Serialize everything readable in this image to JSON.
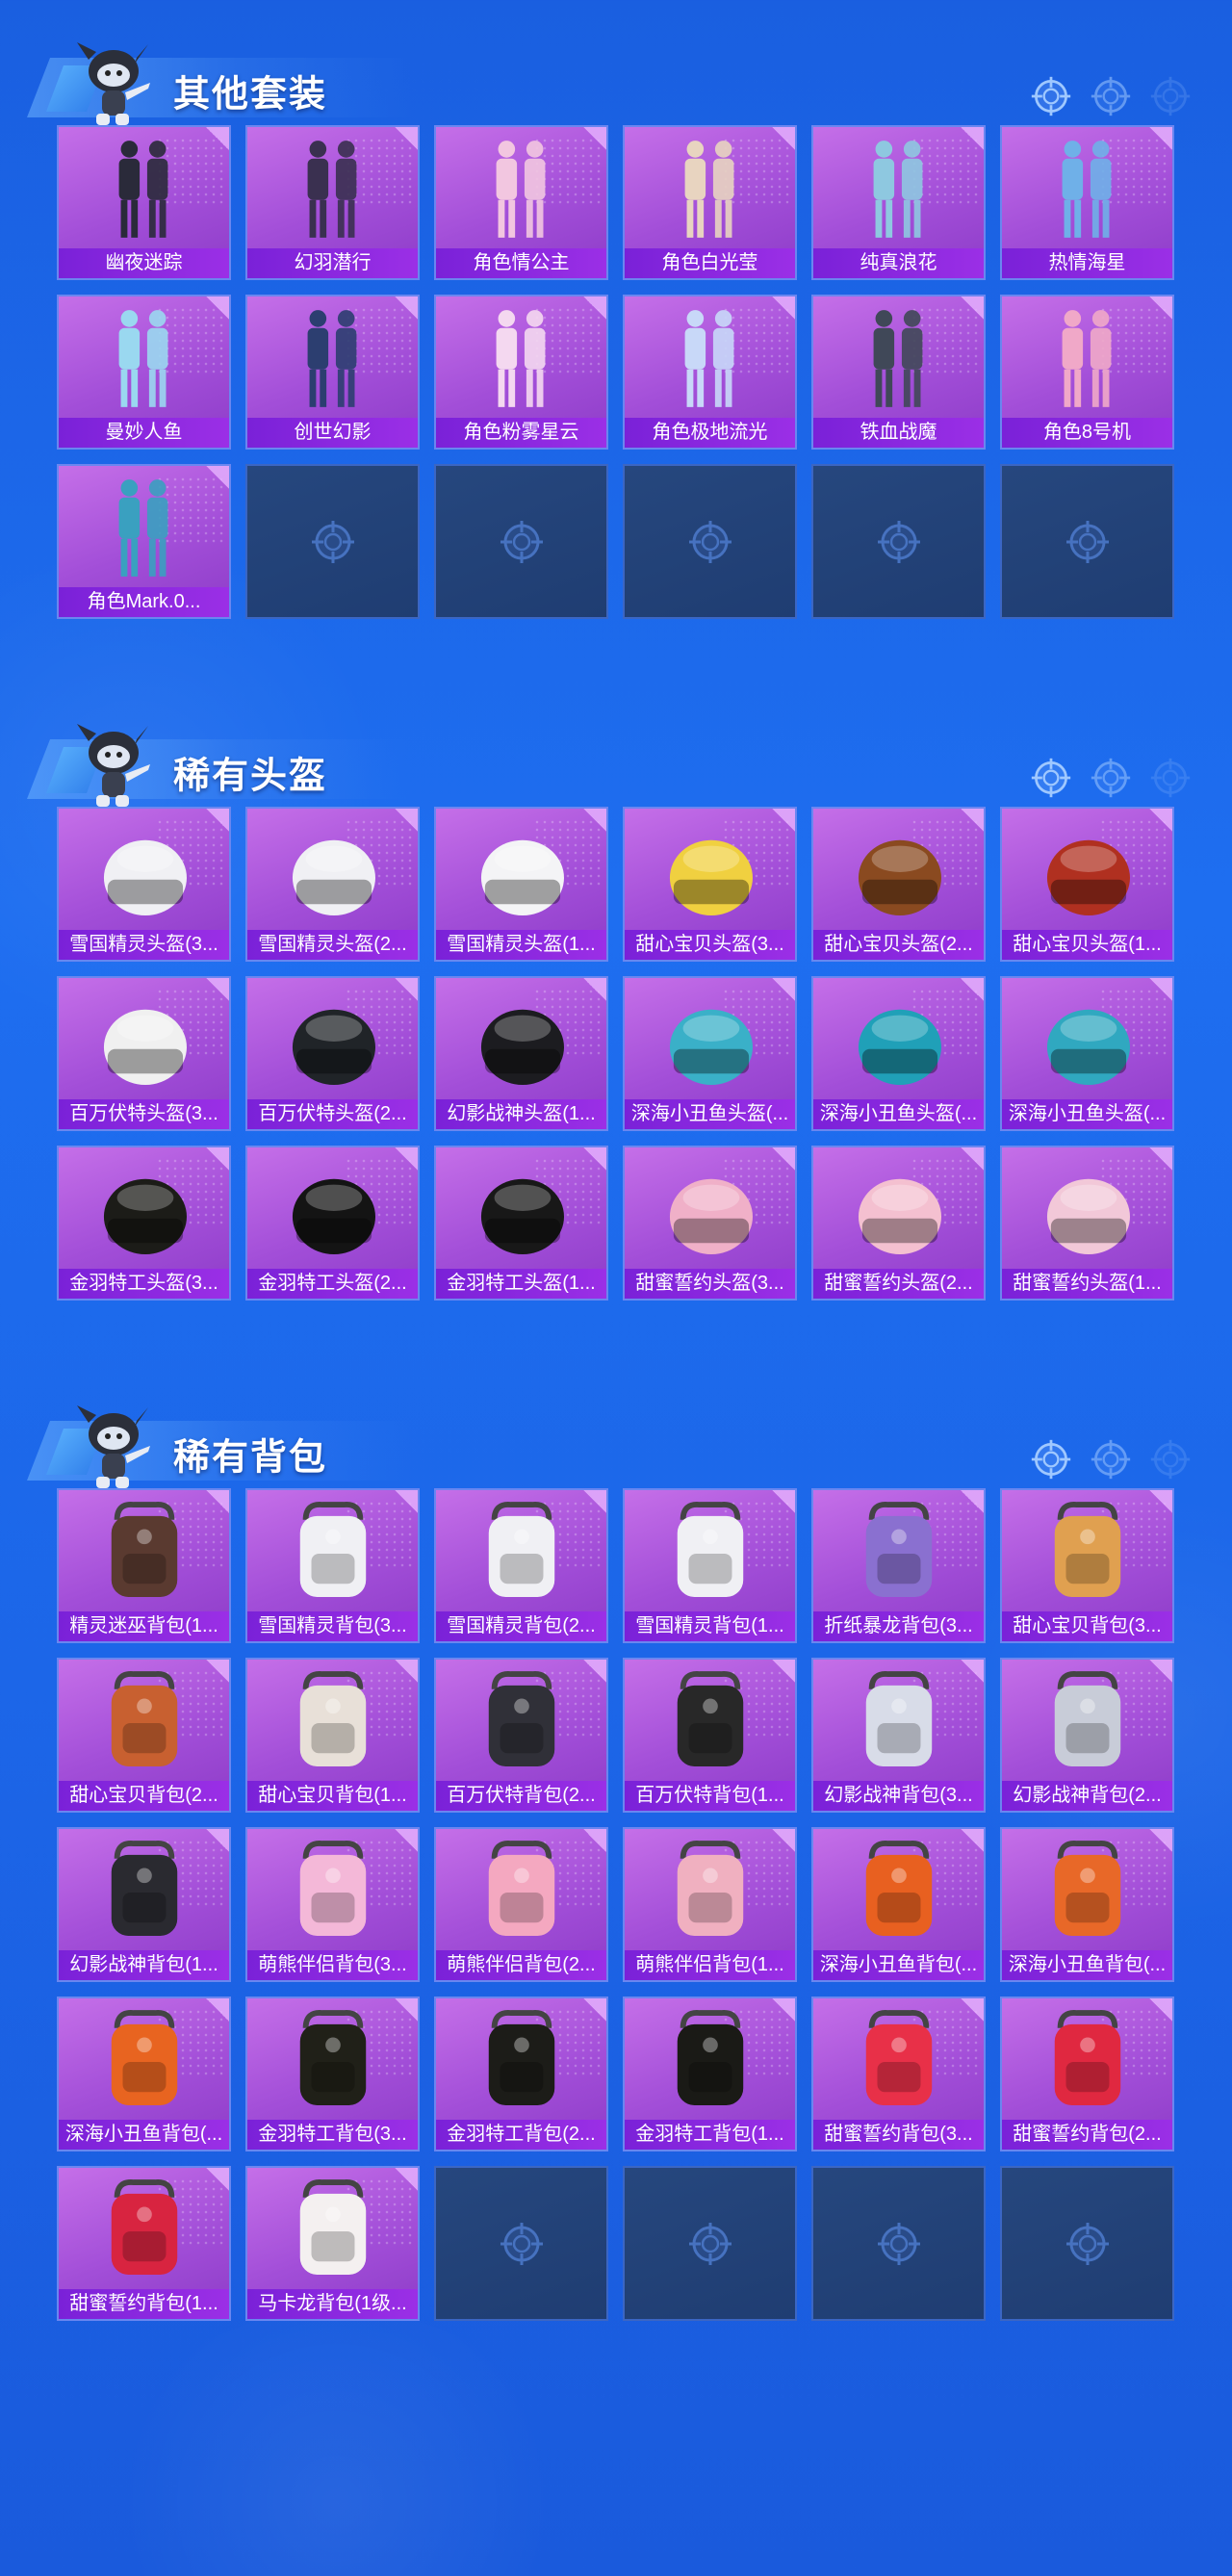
{
  "sections": [
    {
      "title": "其他套装",
      "items": [
        "幽夜迷踪",
        "幻羽潜行",
        "角色情公主",
        "角色白光莹",
        "纯真浪花",
        "热情海星",
        "曼妙人鱼",
        "创世幻影",
        "角色粉雾星云",
        "角色极地流光",
        "铁血战魔",
        "角色8号机",
        "角色Mark.0...",
        "",
        "",
        "",
        "",
        ""
      ]
    },
    {
      "title": "稀有头盔",
      "items": [
        "雪国精灵头盔(3...",
        "雪国精灵头盔(2...",
        "雪国精灵头盔(1...",
        "甜心宝贝头盔(3...",
        "甜心宝贝头盔(2...",
        "甜心宝贝头盔(1...",
        "百万伏特头盔(3...",
        "百万伏特头盔(2...",
        "幻影战神头盔(1...",
        "深海小丑鱼头盔(...",
        "深海小丑鱼头盔(...",
        "深海小丑鱼头盔(...",
        "金羽特工头盔(3...",
        "金羽特工头盔(2...",
        "金羽特工头盔(1...",
        "甜蜜誓约头盔(3...",
        "甜蜜誓约头盔(2...",
        "甜蜜誓约头盔(1..."
      ]
    },
    {
      "title": "稀有背包",
      "items": [
        "精灵迷巫背包(1...",
        "雪国精灵背包(3...",
        "雪国精灵背包(2...",
        "雪国精灵背包(1...",
        "折纸暴龙背包(3...",
        "甜心宝贝背包(3...",
        "甜心宝贝背包(2...",
        "甜心宝贝背包(1...",
        "百万伏特背包(2...",
        "百万伏特背包(1...",
        "幻影战神背包(3...",
        "幻影战神背包(2...",
        "幻影战神背包(1...",
        "萌熊伴侣背包(3...",
        "萌熊伴侣背包(2...",
        "萌熊伴侣背包(1...",
        "深海小丑鱼背包(...",
        "深海小丑鱼背包(...",
        "深海小丑鱼背包(...",
        "金羽特工背包(3...",
        "金羽特工背包(2...",
        "金羽特工背包(1...",
        "甜蜜誓约背包(3...",
        "甜蜜誓约背包(2...",
        "甜蜜誓约背包(1...",
        "马卡龙背包(1级...",
        "",
        "",
        "",
        ""
      ]
    }
  ],
  "icons": {
    "header": "crosshair-icon",
    "empty_slot": "crosshair-icon",
    "mascot": "mascot-icon"
  },
  "colors": {
    "background": "#1c66e8",
    "card": "#a24ed8",
    "label_bar": "#8a28e0",
    "empty_card": "#23427a"
  }
}
